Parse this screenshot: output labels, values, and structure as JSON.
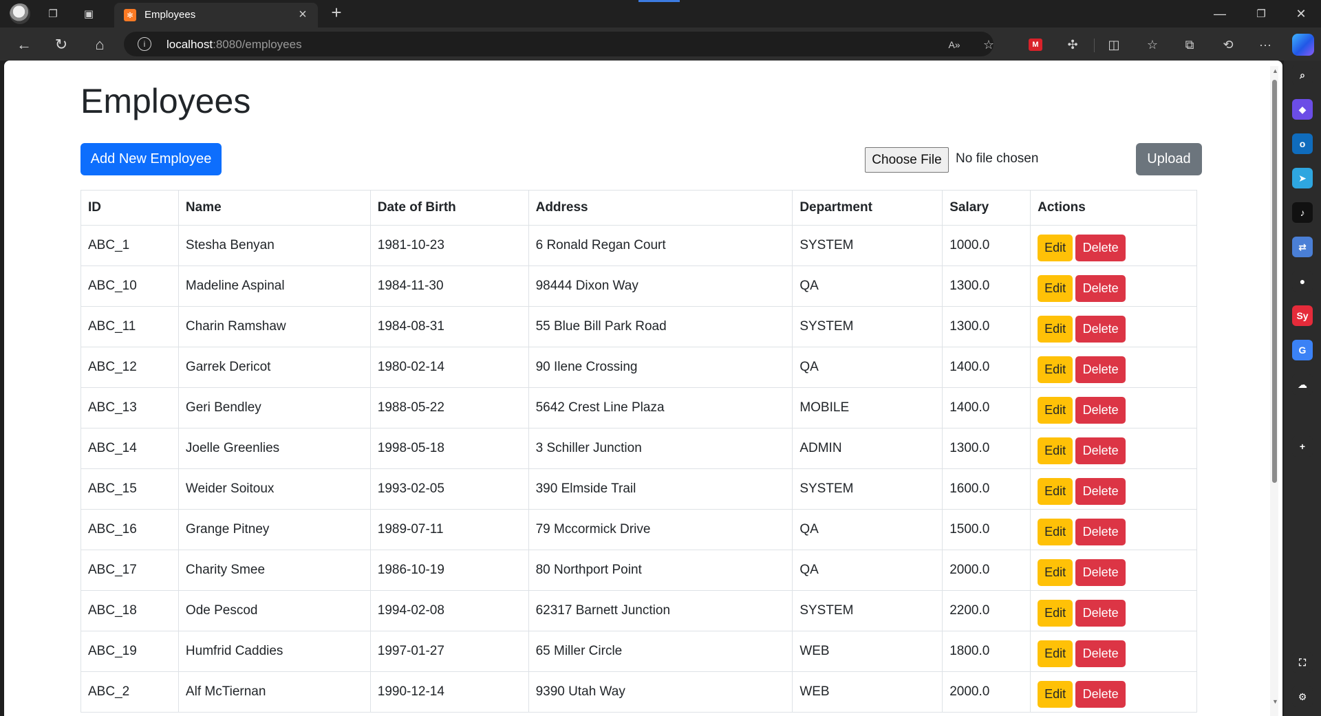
{
  "browser": {
    "tab_title": "Employees",
    "tab_favicon_glyph": "✻",
    "url_host": "localhost",
    "url_rest": ":8080/employees",
    "read_aloud_glyph": "A»",
    "red_extension_glyph": "M"
  },
  "page": {
    "title": "Employees",
    "add_button": "Add New Employee",
    "choose_file_button": "Choose File",
    "file_status": "No file chosen",
    "upload_button": "Upload"
  },
  "table": {
    "headers": [
      "ID",
      "Name",
      "Date of Birth",
      "Address",
      "Department",
      "Salary",
      "Actions"
    ],
    "edit_label": "Edit",
    "delete_label": "Delete",
    "rows": [
      {
        "id": "ABC_1",
        "name": "Stesha Benyan",
        "dob": "1981-10-23",
        "address": "6 Ronald Regan Court",
        "department": "SYSTEM",
        "salary": "1000.0"
      },
      {
        "id": "ABC_10",
        "name": "Madeline Aspinal",
        "dob": "1984-11-30",
        "address": "98444 Dixon Way",
        "department": "QA",
        "salary": "1300.0"
      },
      {
        "id": "ABC_11",
        "name": "Charin Ramshaw",
        "dob": "1984-08-31",
        "address": "55 Blue Bill Park Road",
        "department": "SYSTEM",
        "salary": "1300.0"
      },
      {
        "id": "ABC_12",
        "name": "Garrek Dericot",
        "dob": "1980-02-14",
        "address": "90 Ilene Crossing",
        "department": "QA",
        "salary": "1400.0"
      },
      {
        "id": "ABC_13",
        "name": "Geri Bendley",
        "dob": "1988-05-22",
        "address": "5642 Crest Line Plaza",
        "department": "MOBILE",
        "salary": "1400.0"
      },
      {
        "id": "ABC_14",
        "name": "Joelle Greenlies",
        "dob": "1998-05-18",
        "address": "3 Schiller Junction",
        "department": "ADMIN",
        "salary": "1300.0"
      },
      {
        "id": "ABC_15",
        "name": "Weider Soitoux",
        "dob": "1993-02-05",
        "address": "390 Elmside Trail",
        "department": "SYSTEM",
        "salary": "1600.0"
      },
      {
        "id": "ABC_16",
        "name": "Grange Pitney",
        "dob": "1989-07-11",
        "address": "79 Mccormick Drive",
        "department": "QA",
        "salary": "1500.0"
      },
      {
        "id": "ABC_17",
        "name": "Charity Smee",
        "dob": "1986-10-19",
        "address": "80 Northport Point",
        "department": "QA",
        "salary": "2000.0"
      },
      {
        "id": "ABC_18",
        "name": "Ode Pescod",
        "dob": "1994-02-08",
        "address": "62317 Barnett Junction",
        "department": "SYSTEM",
        "salary": "2200.0"
      },
      {
        "id": "ABC_19",
        "name": "Humfrid Caddies",
        "dob": "1997-01-27",
        "address": "65 Miller Circle",
        "department": "WEB",
        "salary": "1800.0"
      },
      {
        "id": "ABC_2",
        "name": "Alf McTiernan",
        "dob": "1990-12-14",
        "address": "9390 Utah Way",
        "department": "WEB",
        "salary": "2000.0"
      }
    ]
  },
  "sidebar": {
    "items": [
      {
        "name": "search-icon",
        "glyph": "⌕",
        "color": "#2b2b2b"
      },
      {
        "name": "copilot-app-icon",
        "glyph": "◆",
        "color": "#6b4de6"
      },
      {
        "name": "outlook-icon",
        "glyph": "o",
        "color": "#0f6cbd"
      },
      {
        "name": "telegram-icon",
        "glyph": "➤",
        "color": "#2ea6e0"
      },
      {
        "name": "tiktok-icon",
        "glyph": "♪",
        "color": "#111111"
      },
      {
        "name": "translate-icon",
        "glyph": "⇄",
        "color": "#4a7fd6"
      },
      {
        "name": "github-icon",
        "glyph": "●",
        "color": "#2b2b2b"
      },
      {
        "name": "symbaloo-icon",
        "glyph": "Sy",
        "color": "#e52b3a"
      },
      {
        "name": "google-translate-icon",
        "glyph": "G",
        "color": "#3b82f6"
      },
      {
        "name": "onedrive-icon",
        "glyph": "☁",
        "color": "#2b2b2b"
      },
      {
        "name": "add-sidebar-app-icon",
        "glyph": "+",
        "color": "#2b2b2b"
      },
      {
        "name": "screenshot-icon",
        "glyph": "⛶",
        "color": "#2b2b2b"
      },
      {
        "name": "sidebar-settings-icon",
        "glyph": "⚙",
        "color": "#2b2b2b"
      }
    ]
  }
}
